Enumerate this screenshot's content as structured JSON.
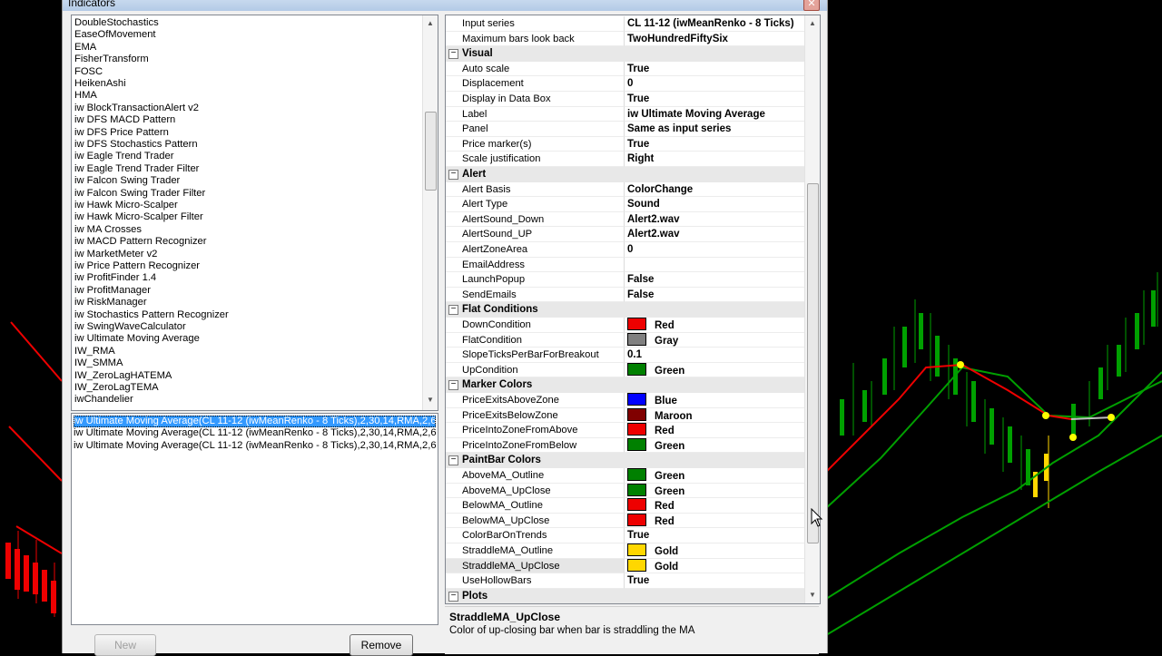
{
  "window": {
    "title": "Indicators",
    "close_glyph": "✕"
  },
  "indicator_list": [
    "DoubleStochastics",
    "EaseOfMovement",
    "EMA",
    "FisherTransform",
    "FOSC",
    "HeikenAshi",
    "HMA",
    "iw BlockTransactionAlert v2",
    "iw DFS MACD Pattern",
    "iw DFS Price Pattern",
    "iw DFS Stochastics Pattern",
    "iw Eagle Trend Trader",
    "iw Eagle Trend Trader Filter",
    "iw Falcon Swing Trader",
    "iw Falcon Swing Trader Filter",
    "iw Hawk Micro-Scalper",
    "iw Hawk Micro-Scalper Filter",
    "iw MA Crosses",
    "iw MACD Pattern Recognizer",
    "iw MarketMeter v2",
    "iw Price Pattern Recognizer",
    "iw ProfitFinder 1.4",
    "iw ProfitManager",
    "iw RiskManager",
    "iw Stochastics Pattern Recognizer",
    "iw SwingWaveCalculator",
    "iw Ultimate Moving Average",
    "IW_RMA",
    "IW_SMMA",
    "IW_ZeroLagHATEMA",
    "IW_ZeroLagTEMA",
    "iwChandelier"
  ],
  "instances": [
    "iw Ultimate Moving Average(CL 11-12 (iwMeanRenko - 8 Ticks),2,30,14,RMA,2,6",
    "iw Ultimate Moving Average(CL 11-12 (iwMeanRenko - 8 Ticks),2,30,14,RMA,2,6",
    "iw Ultimate Moving Average(CL 11-12 (iwMeanRenko - 8 Ticks),2,30,14,RMA,2,6"
  ],
  "buttons": {
    "new": "New",
    "remove": "Remove"
  },
  "colors": {
    "Red": "#ee0000",
    "Gray": "#808080",
    "Green": "#008000",
    "Blue": "#0000ff",
    "Maroon": "#800000",
    "Gold": "#ffd700"
  },
  "properties": [
    {
      "kind": "prop",
      "name": "Input series",
      "value": "CL 11-12 (iwMeanRenko - 8 Ticks)"
    },
    {
      "kind": "prop",
      "name": "Maximum bars look back",
      "value": "TwoHundredFiftySix"
    },
    {
      "kind": "cat",
      "name": "Visual"
    },
    {
      "kind": "prop",
      "name": "Auto scale",
      "value": "True"
    },
    {
      "kind": "prop",
      "name": "Displacement",
      "value": "0"
    },
    {
      "kind": "prop",
      "name": "Display in Data Box",
      "value": "True"
    },
    {
      "kind": "prop",
      "name": "Label",
      "value": "iw Ultimate Moving Average"
    },
    {
      "kind": "prop",
      "name": "Panel",
      "value": "Same as input series"
    },
    {
      "kind": "prop",
      "name": "Price marker(s)",
      "value": "True"
    },
    {
      "kind": "prop",
      "name": "Scale justification",
      "value": "Right"
    },
    {
      "kind": "cat",
      "name": "Alert"
    },
    {
      "kind": "prop",
      "name": "Alert Basis",
      "value": "ColorChange"
    },
    {
      "kind": "prop",
      "name": "Alert Type",
      "value": "Sound"
    },
    {
      "kind": "prop",
      "name": "AlertSound_Down",
      "value": "Alert2.wav"
    },
    {
      "kind": "prop",
      "name": "AlertSound_UP",
      "value": "Alert2.wav"
    },
    {
      "kind": "prop",
      "name": "AlertZoneArea",
      "value": "0"
    },
    {
      "kind": "prop",
      "name": "EmailAddress",
      "value": ""
    },
    {
      "kind": "prop",
      "name": "LaunchPopup",
      "value": "False"
    },
    {
      "kind": "prop",
      "name": "SendEmails",
      "value": "False"
    },
    {
      "kind": "cat",
      "name": "Flat Conditions"
    },
    {
      "kind": "prop",
      "name": "DownCondition",
      "value": "Red",
      "swatch": "Red"
    },
    {
      "kind": "prop",
      "name": "FlatCondition",
      "value": "Gray",
      "swatch": "Gray"
    },
    {
      "kind": "prop",
      "name": "SlopeTicksPerBarForBreakout",
      "value": "0.1"
    },
    {
      "kind": "prop",
      "name": "UpCondition",
      "value": "Green",
      "swatch": "Green"
    },
    {
      "kind": "cat",
      "name": "Marker Colors"
    },
    {
      "kind": "prop",
      "name": "PriceExitsAboveZone",
      "value": "Blue",
      "swatch": "Blue"
    },
    {
      "kind": "prop",
      "name": "PriceExitsBelowZone",
      "value": "Maroon",
      "swatch": "Maroon"
    },
    {
      "kind": "prop",
      "name": "PriceIntoZoneFromAbove",
      "value": "Red",
      "swatch": "Red"
    },
    {
      "kind": "prop",
      "name": "PriceIntoZoneFromBelow",
      "value": "Green",
      "swatch": "Green"
    },
    {
      "kind": "cat",
      "name": "PaintBar Colors"
    },
    {
      "kind": "prop",
      "name": "AboveMA_Outline",
      "value": "Green",
      "swatch": "Green"
    },
    {
      "kind": "prop",
      "name": "AboveMA_UpClose",
      "value": "Green",
      "swatch": "Green"
    },
    {
      "kind": "prop",
      "name": "BelowMA_Outline",
      "value": "Red",
      "swatch": "Red"
    },
    {
      "kind": "prop",
      "name": "BelowMA_UpClose",
      "value": "Red",
      "swatch": "Red"
    },
    {
      "kind": "prop",
      "name": "ColorBarOnTrends",
      "value": "True"
    },
    {
      "kind": "prop",
      "name": "StraddleMA_Outline",
      "value": "Gold",
      "swatch": "Gold"
    },
    {
      "kind": "prop",
      "name": "StraddleMA_UpClose",
      "value": "Gold",
      "swatch": "Gold",
      "selected": true
    },
    {
      "kind": "prop",
      "name": "UseHollowBars",
      "value": "True"
    },
    {
      "kind": "cat",
      "name": "Plots"
    }
  ],
  "description": {
    "title": "StraddleMA_UpClose",
    "text": "Color of up-closing bar when bar is straddling the MA"
  },
  "chart_colors": {
    "background": "#000000",
    "red_ma": "#ee0000",
    "green_ma": "#00a000",
    "marker": "#ffff00"
  }
}
